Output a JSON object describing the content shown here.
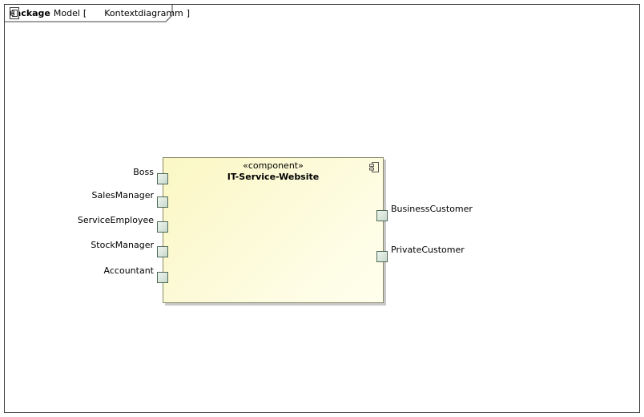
{
  "frame": {
    "keyword": "package",
    "owner": "Model",
    "open_bracket": "[",
    "diagram_name": "Kontextdiagramm",
    "close_bracket": "]",
    "diagram_icon": "component-diagram-icon"
  },
  "component": {
    "stereotype": "«component»",
    "name": "IT-Service-Website",
    "icon": "component-icon",
    "fill_color": "#fbf7c4",
    "border_color": "#8a8a6a"
  },
  "ports": {
    "left": [
      {
        "label": "Boss"
      },
      {
        "label": "SalesManager"
      },
      {
        "label": "ServiceEmployee"
      },
      {
        "label": "StockManager"
      },
      {
        "label": "Accountant"
      }
    ],
    "right": [
      {
        "label": "BusinessCustomer"
      },
      {
        "label": "PrivateCustomer"
      }
    ]
  },
  "colors": {
    "port_border": "#4f6b57",
    "port_fill": "#c9d9cc"
  }
}
